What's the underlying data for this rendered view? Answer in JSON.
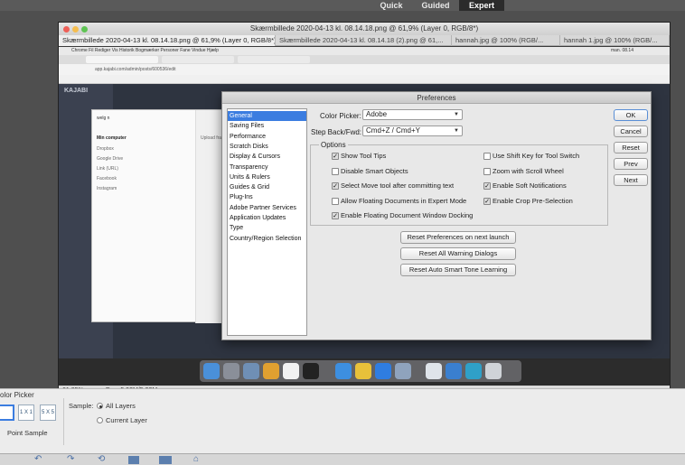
{
  "modebar": {
    "modes": [
      "Quick",
      "Guided",
      "Expert"
    ],
    "active": "Expert"
  },
  "document": {
    "title": "Skærmbillede 2020-04-13 kl. 08.14.18.png @ 61,9% (Layer 0, RGB/8*)",
    "tabs": [
      "Skærmbillede 2020-04-13 kl. 08.14.18.png @ 61,9% (Layer 0, RGB/8*)",
      "Skærmbillede 2020-04-13 kl. 08.14.18 (2).png @ 61,...",
      "hannah.jpg @ 100% (RGB/...",
      "hannah 1.jpg @ 100% (RGB/..."
    ],
    "status_zoom": "61,85%",
    "status_doc": "Doc: 5,93M/5,93M"
  },
  "screenshot": {
    "menubar": "Chrome   Fil   Rediger   Vis   Historik   Bogmærker   Personer   Fane   Vindue   Hjælp",
    "clock": "man. 08.14",
    "url": "app.kajabi.com/admin/posts/600536/edit",
    "logo": "KAJABI",
    "dialog_search": "welg n",
    "dialog_items": [
      "Min computer",
      "Dropbox",
      "Google Drive",
      "Link (URL)",
      "Facebook",
      "Instagram"
    ],
    "dialog_right": "Upload fra din computer"
  },
  "preferences": {
    "title": "Preferences",
    "categories": [
      "General",
      "Saving Files",
      "Performance",
      "Scratch Disks",
      "Display & Cursors",
      "Transparency",
      "Units & Rulers",
      "Guides & Grid",
      "Plug-Ins",
      "Adobe Partner Services",
      "Application Updates",
      "Type",
      "Country/Region Selection"
    ],
    "selected_category": "General",
    "color_picker_label": "Color Picker:",
    "color_picker_value": "Adobe",
    "step_label": "Step Back/Fwd:",
    "step_value": "Cmd+Z / Cmd+Y",
    "options_title": "Options",
    "options_left": [
      {
        "label": "Show Tool Tips",
        "checked": true
      },
      {
        "label": "Disable Smart Objects",
        "checked": false
      },
      {
        "label": "Select Move tool after committing text",
        "checked": true
      },
      {
        "label": "Allow Floating Documents in Expert Mode",
        "checked": false
      },
      {
        "label": "Enable Floating Document Window Docking",
        "checked": true
      }
    ],
    "options_right": [
      {
        "label": "Use Shift Key for Tool Switch",
        "checked": false
      },
      {
        "label": "Zoom with Scroll Wheel",
        "checked": false
      },
      {
        "label": "Enable Soft Notifications",
        "checked": true
      },
      {
        "label": "Enable Crop Pre-Selection",
        "checked": true
      }
    ],
    "reset_buttons": [
      "Reset Preferences on next launch",
      "Reset All Warning Dialogs",
      "Reset Auto Smart Tone Learning"
    ],
    "side_buttons": [
      "OK",
      "Cancel",
      "Reset",
      "Prev",
      "Next"
    ]
  },
  "bottom_panel": {
    "tool_name": "olor Picker",
    "sample_sizes": [
      "1 X 1",
      "5 X 5"
    ],
    "point_sample": "Point Sample",
    "sample_label": "Sample:",
    "sample_options": [
      {
        "label": "All Layers",
        "selected": true
      },
      {
        "label": "Current Layer",
        "selected": false
      }
    ]
  }
}
